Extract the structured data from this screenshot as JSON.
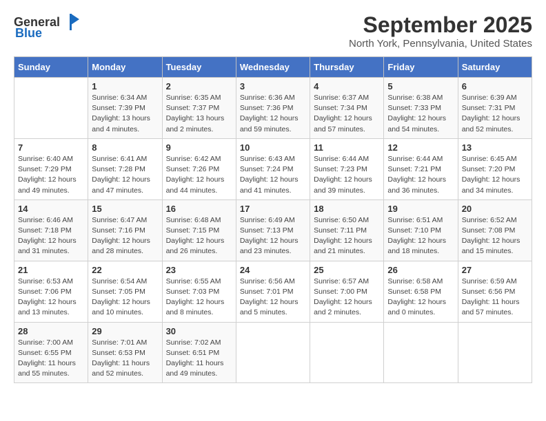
{
  "logo": {
    "general": "General",
    "blue": "Blue"
  },
  "title": "September 2025",
  "subtitle": "North York, Pennsylvania, United States",
  "days_header": [
    "Sunday",
    "Monday",
    "Tuesday",
    "Wednesday",
    "Thursday",
    "Friday",
    "Saturday"
  ],
  "weeks": [
    [
      {
        "day": "",
        "info": ""
      },
      {
        "day": "1",
        "info": "Sunrise: 6:34 AM\nSunset: 7:39 PM\nDaylight: 13 hours\nand 4 minutes."
      },
      {
        "day": "2",
        "info": "Sunrise: 6:35 AM\nSunset: 7:37 PM\nDaylight: 13 hours\nand 2 minutes."
      },
      {
        "day": "3",
        "info": "Sunrise: 6:36 AM\nSunset: 7:36 PM\nDaylight: 12 hours\nand 59 minutes."
      },
      {
        "day": "4",
        "info": "Sunrise: 6:37 AM\nSunset: 7:34 PM\nDaylight: 12 hours\nand 57 minutes."
      },
      {
        "day": "5",
        "info": "Sunrise: 6:38 AM\nSunset: 7:33 PM\nDaylight: 12 hours\nand 54 minutes."
      },
      {
        "day": "6",
        "info": "Sunrise: 6:39 AM\nSunset: 7:31 PM\nDaylight: 12 hours\nand 52 minutes."
      }
    ],
    [
      {
        "day": "7",
        "info": "Sunrise: 6:40 AM\nSunset: 7:29 PM\nDaylight: 12 hours\nand 49 minutes."
      },
      {
        "day": "8",
        "info": "Sunrise: 6:41 AM\nSunset: 7:28 PM\nDaylight: 12 hours\nand 47 minutes."
      },
      {
        "day": "9",
        "info": "Sunrise: 6:42 AM\nSunset: 7:26 PM\nDaylight: 12 hours\nand 44 minutes."
      },
      {
        "day": "10",
        "info": "Sunrise: 6:43 AM\nSunset: 7:24 PM\nDaylight: 12 hours\nand 41 minutes."
      },
      {
        "day": "11",
        "info": "Sunrise: 6:44 AM\nSunset: 7:23 PM\nDaylight: 12 hours\nand 39 minutes."
      },
      {
        "day": "12",
        "info": "Sunrise: 6:44 AM\nSunset: 7:21 PM\nDaylight: 12 hours\nand 36 minutes."
      },
      {
        "day": "13",
        "info": "Sunrise: 6:45 AM\nSunset: 7:20 PM\nDaylight: 12 hours\nand 34 minutes."
      }
    ],
    [
      {
        "day": "14",
        "info": "Sunrise: 6:46 AM\nSunset: 7:18 PM\nDaylight: 12 hours\nand 31 minutes."
      },
      {
        "day": "15",
        "info": "Sunrise: 6:47 AM\nSunset: 7:16 PM\nDaylight: 12 hours\nand 28 minutes."
      },
      {
        "day": "16",
        "info": "Sunrise: 6:48 AM\nSunset: 7:15 PM\nDaylight: 12 hours\nand 26 minutes."
      },
      {
        "day": "17",
        "info": "Sunrise: 6:49 AM\nSunset: 7:13 PM\nDaylight: 12 hours\nand 23 minutes."
      },
      {
        "day": "18",
        "info": "Sunrise: 6:50 AM\nSunset: 7:11 PM\nDaylight: 12 hours\nand 21 minutes."
      },
      {
        "day": "19",
        "info": "Sunrise: 6:51 AM\nSunset: 7:10 PM\nDaylight: 12 hours\nand 18 minutes."
      },
      {
        "day": "20",
        "info": "Sunrise: 6:52 AM\nSunset: 7:08 PM\nDaylight: 12 hours\nand 15 minutes."
      }
    ],
    [
      {
        "day": "21",
        "info": "Sunrise: 6:53 AM\nSunset: 7:06 PM\nDaylight: 12 hours\nand 13 minutes."
      },
      {
        "day": "22",
        "info": "Sunrise: 6:54 AM\nSunset: 7:05 PM\nDaylight: 12 hours\nand 10 minutes."
      },
      {
        "day": "23",
        "info": "Sunrise: 6:55 AM\nSunset: 7:03 PM\nDaylight: 12 hours\nand 8 minutes."
      },
      {
        "day": "24",
        "info": "Sunrise: 6:56 AM\nSunset: 7:01 PM\nDaylight: 12 hours\nand 5 minutes."
      },
      {
        "day": "25",
        "info": "Sunrise: 6:57 AM\nSunset: 7:00 PM\nDaylight: 12 hours\nand 2 minutes."
      },
      {
        "day": "26",
        "info": "Sunrise: 6:58 AM\nSunset: 6:58 PM\nDaylight: 12 hours\nand 0 minutes."
      },
      {
        "day": "27",
        "info": "Sunrise: 6:59 AM\nSunset: 6:56 PM\nDaylight: 11 hours\nand 57 minutes."
      }
    ],
    [
      {
        "day": "28",
        "info": "Sunrise: 7:00 AM\nSunset: 6:55 PM\nDaylight: 11 hours\nand 55 minutes."
      },
      {
        "day": "29",
        "info": "Sunrise: 7:01 AM\nSunset: 6:53 PM\nDaylight: 11 hours\nand 52 minutes."
      },
      {
        "day": "30",
        "info": "Sunrise: 7:02 AM\nSunset: 6:51 PM\nDaylight: 11 hours\nand 49 minutes."
      },
      {
        "day": "",
        "info": ""
      },
      {
        "day": "",
        "info": ""
      },
      {
        "day": "",
        "info": ""
      },
      {
        "day": "",
        "info": ""
      }
    ]
  ]
}
